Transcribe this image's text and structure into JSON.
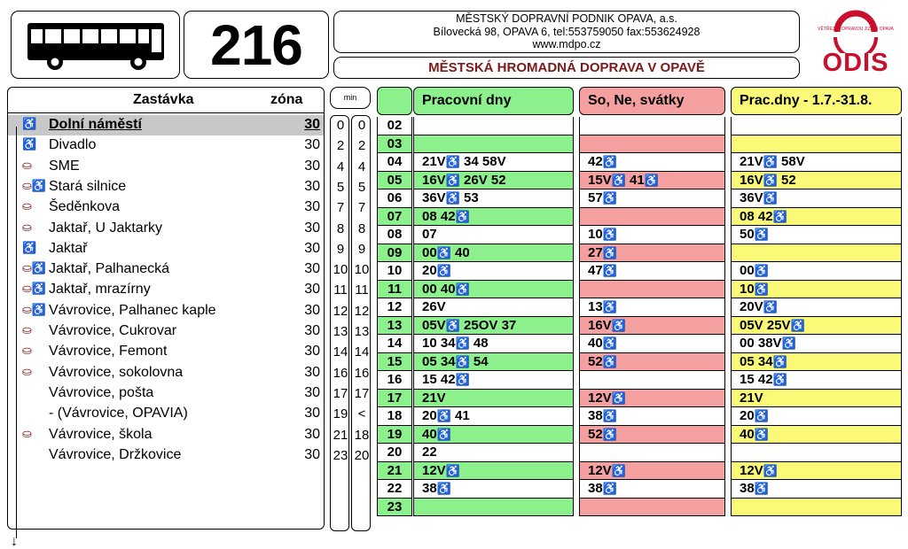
{
  "route": {
    "number": "216"
  },
  "company": {
    "name": "MĚSTSKÝ DOPRAVNÍ PODNIK OPAVA, a.s.",
    "address": "Bílovecká 98, OPAVA 6,  tel:553759050  fax:553624928",
    "web": "www.mdpo.cz"
  },
  "title": "MĚSTSKÁ HROMADNÁ DOPRAVA V OPAVĚ",
  "logo": {
    "text": "ODIS",
    "small_text": "VĚTŘEJTE OPRAVDU JIZDNÍ OPAVA"
  },
  "colors": {
    "weekday": "#8cf08c",
    "weekend": "#f4a0a0",
    "summer": "#fafa78",
    "highlight": "#c8c8c8",
    "logo_red": "#c8102e",
    "title_red": "#7d1a1a"
  },
  "stops_header": {
    "stop": "Zastávka",
    "zone": "zóna"
  },
  "min_label": "min",
  "stops": [
    {
      "name": "Dolní náměstí",
      "zone": "30",
      "min1": "0",
      "min2": "0",
      "icon": "♿",
      "highlight": true
    },
    {
      "name": "Divadlo",
      "zone": "30",
      "min1": "2",
      "min2": "2",
      "icon": "♿"
    },
    {
      "name": "SME",
      "zone": "30",
      "min1": "4",
      "min2": "4",
      "icon": "⛀"
    },
    {
      "name": "Stará silnice",
      "zone": "30",
      "min1": "5",
      "min2": "5",
      "icon": "⛀♿"
    },
    {
      "name": "Šeděnkova",
      "zone": "30",
      "min1": "7",
      "min2": "7",
      "icon": "⛀"
    },
    {
      "name": "Jaktař, U Jaktarky",
      "zone": "30",
      "min1": "8",
      "min2": "8",
      "icon": "⛀"
    },
    {
      "name": "Jaktař",
      "zone": "30",
      "min1": "9",
      "min2": "9",
      "icon": "♿"
    },
    {
      "name": "Jaktař, Palhanecká",
      "zone": "30",
      "min1": "10",
      "min2": "10",
      "icon": "⛀♿"
    },
    {
      "name": "Jaktař, mrazírny",
      "zone": "30",
      "min1": "11",
      "min2": "11",
      "icon": "⛀♿"
    },
    {
      "name": "Vávrovice, Palhanec kaple",
      "zone": "30",
      "min1": "12",
      "min2": "12",
      "icon": "⛀♿"
    },
    {
      "name": "Vávrovice, Cukrovar",
      "zone": "30",
      "min1": "13",
      "min2": "13",
      "icon": "⛀"
    },
    {
      "name": "Vávrovice, Femont",
      "zone": "30",
      "min1": "14",
      "min2": "14",
      "icon": "⛀"
    },
    {
      "name": "Vávrovice, sokolovna",
      "zone": "30",
      "min1": "16",
      "min2": "16",
      "icon": "⛀"
    },
    {
      "name": "Vávrovice, pošta",
      "zone": "30",
      "min1": "17",
      "min2": "17",
      "icon": ""
    },
    {
      "name": "  - (Vávrovice, OPAVIA)",
      "zone": "30",
      "min1": "19",
      "min2": "<",
      "icon": ""
    },
    {
      "name": "Vávrovice, škola",
      "zone": "30",
      "min1": "21",
      "min2": "18",
      "icon": "⛀"
    },
    {
      "name": "Vávrovice, Držkovice",
      "zone": "30",
      "min1": "23",
      "min2": "20",
      "icon": ""
    }
  ],
  "timetable": {
    "headers": {
      "weekday": "Pracovní dny",
      "weekend": "So, Ne, svátky",
      "summer": "Prac.dny - 1.7.-31.8."
    },
    "rows": [
      {
        "hour": "02",
        "weekday": "",
        "weekend": "",
        "summer": ""
      },
      {
        "hour": "03",
        "weekday": "",
        "weekend": "",
        "summer": ""
      },
      {
        "hour": "04",
        "weekday": "21V♿ 34 58V",
        "weekend": "42♿",
        "summer": "21V♿ 58V"
      },
      {
        "hour": "05",
        "weekday": "16V♿ 26V 52",
        "weekend": "15V♿ 41♿",
        "summer": "16V♿ 52"
      },
      {
        "hour": "06",
        "weekday": "36V♿ 53",
        "weekend": "57♿",
        "summer": "36V♿"
      },
      {
        "hour": "07",
        "weekday": "08 42♿",
        "weekend": "",
        "summer": "08 42♿"
      },
      {
        "hour": "08",
        "weekday": "07",
        "weekend": "10♿",
        "summer": "50♿"
      },
      {
        "hour": "09",
        "weekday": "00♿ 40",
        "weekend": "27♿",
        "summer": ""
      },
      {
        "hour": "10",
        "weekday": "20♿",
        "weekend": "47♿",
        "summer": "00♿"
      },
      {
        "hour": "11",
        "weekday": "00 40♿",
        "weekend": "",
        "summer": "10♿"
      },
      {
        "hour": "12",
        "weekday": "26V",
        "weekend": "13♿",
        "summer": "20V♿"
      },
      {
        "hour": "13",
        "weekday": "05V♿ 25OV 37",
        "weekend": "16V♿",
        "summer": "05V 25V♿"
      },
      {
        "hour": "14",
        "weekday": "10 34♿ 48",
        "weekend": "40♿",
        "summer": "00 38V♿"
      },
      {
        "hour": "15",
        "weekday": "05 34♿ 54",
        "weekend": "52♿",
        "summer": "05 34♿"
      },
      {
        "hour": "16",
        "weekday": "15 42♿",
        "weekend": "",
        "summer": "15 42♿"
      },
      {
        "hour": "17",
        "weekday": "21V",
        "weekend": "12V♿",
        "summer": "21V"
      },
      {
        "hour": "18",
        "weekday": "20♿ 41",
        "weekend": "38♿",
        "summer": "20♿"
      },
      {
        "hour": "19",
        "weekday": "40♿",
        "weekend": "52♿",
        "summer": "40♿"
      },
      {
        "hour": "20",
        "weekday": "22",
        "weekend": "",
        "summer": ""
      },
      {
        "hour": "21",
        "weekday": "12V♿",
        "weekend": "12V♿",
        "summer": "12V♿"
      },
      {
        "hour": "22",
        "weekday": "38♿",
        "weekend": "38♿",
        "summer": "38♿"
      },
      {
        "hour": "23",
        "weekday": "",
        "weekend": "",
        "summer": ""
      }
    ]
  }
}
